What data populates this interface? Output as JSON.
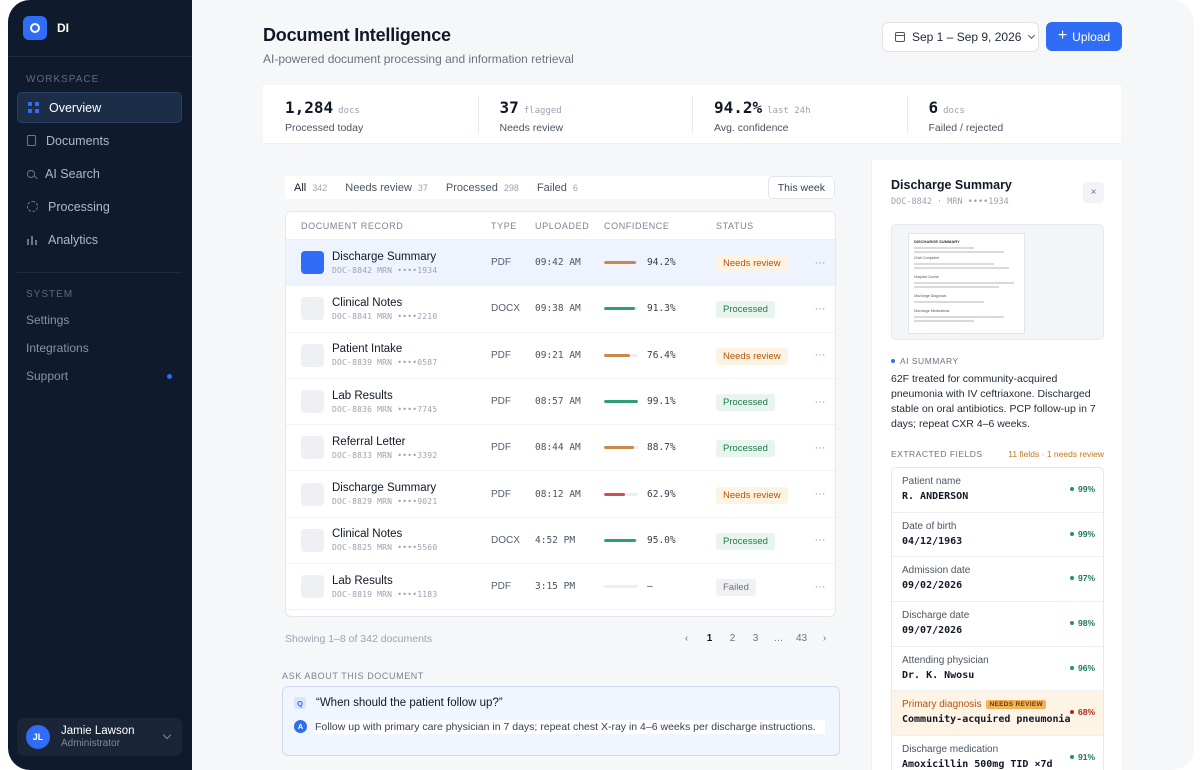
{
  "brand": {
    "name": "DI"
  },
  "sidebar": {
    "workspace_label": "WORKSPACE",
    "items": [
      {
        "label": "Overview",
        "icon": "grid-icon",
        "active": true
      },
      {
        "label": "Documents",
        "icon": "document-icon"
      },
      {
        "label": "AI Search",
        "icon": "search-icon"
      },
      {
        "label": "Processing",
        "icon": "gear-icon"
      },
      {
        "label": "Analytics",
        "icon": "bar-chart-icon"
      }
    ],
    "system_label": "SYSTEM",
    "system_items": [
      {
        "label": "Settings"
      },
      {
        "label": "Integrations"
      },
      {
        "label": "Support",
        "has_dot": true
      }
    ],
    "user": {
      "initials": "JL",
      "name": "Jamie Lawson",
      "role": "Administrator"
    }
  },
  "header": {
    "title": "Document Intelligence",
    "subtitle": "AI-powered document processing and information retrieval",
    "date_range": "Sep 1 – Sep 9, 2026",
    "upload_label": "Upload"
  },
  "stats": [
    {
      "value": "1,284",
      "unit": "docs",
      "label": "Processed today"
    },
    {
      "value": "37",
      "unit": "flagged",
      "label": "Needs review"
    },
    {
      "value": "94.2%",
      "unit": "last 24h",
      "label": "Avg. confidence"
    },
    {
      "value": "6",
      "unit": "docs",
      "label": "Failed / rejected"
    }
  ],
  "tabs": [
    {
      "label": "All",
      "count": "342",
      "active": true
    },
    {
      "label": "Needs review",
      "count": "37"
    },
    {
      "label": "Processed",
      "count": "298"
    },
    {
      "label": "Failed",
      "count": "6"
    }
  ],
  "week_label": "This week",
  "table": {
    "headers": [
      "DOCUMENT RECORD",
      "TYPE",
      "UPLOADED",
      "CONFIDENCE",
      "STATUS"
    ],
    "rows": [
      {
        "name": "Discharge Summary",
        "sub": "DOC-8842  MRN ••••1934",
        "type": "PDF",
        "uploaded": "09:42 AM",
        "confidence": "94.2%",
        "conf_value": 0.942,
        "bar_color": "#c8894a",
        "status": "Needs review",
        "status_kind": "review",
        "selected": true
      },
      {
        "name": "Clinical Notes",
        "sub": "DOC-8841  MRN ••••2210",
        "type": "DOCX",
        "uploaded": "09:38 AM",
        "confidence": "91.3%",
        "conf_value": 0.913,
        "bar_color": "#2e9e73",
        "status": "Processed",
        "status_kind": "processed"
      },
      {
        "name": "Patient Intake",
        "sub": "DOC-8839  MRN ••••0587",
        "type": "PDF",
        "uploaded": "09:21 AM",
        "confidence": "76.4%",
        "conf_value": 0.764,
        "bar_color": "#c8894a",
        "status": "Needs review",
        "status_kind": "review"
      },
      {
        "name": "Lab Results",
        "sub": "DOC-8836  MRN ••••7745",
        "type": "PDF",
        "uploaded": "08:57 AM",
        "confidence": "99.1%",
        "conf_value": 0.991,
        "bar_color": "#2e9e73",
        "status": "Processed",
        "status_kind": "processed"
      },
      {
        "name": "Referral Letter",
        "sub": "DOC-8833  MRN ••••3392",
        "type": "PDF",
        "uploaded": "08:44 AM",
        "confidence": "88.7%",
        "conf_value": 0.887,
        "bar_color": "#c8894a",
        "status": "Processed",
        "status_kind": "processed"
      },
      {
        "name": "Discharge Summary",
        "sub": "DOC-8829  MRN ••••9021",
        "type": "PDF",
        "uploaded": "08:12 AM",
        "confidence": "62.9%",
        "conf_value": 0.629,
        "bar_color": "#d05050",
        "status": "Needs review",
        "status_kind": "review"
      },
      {
        "name": "Clinical Notes",
        "sub": "DOC-8825  MRN ••••5560",
        "type": "DOCX",
        "uploaded": "4:52 PM",
        "confidence": "95.0%",
        "conf_value": 0.95,
        "bar_color": "#2e9e73",
        "status": "Processed",
        "status_kind": "processed"
      },
      {
        "name": "Lab Results",
        "sub": "DOC-8819  MRN ••••1183",
        "type": "PDF",
        "uploaded": "3:15 PM",
        "confidence": "—",
        "conf_value": 0,
        "bar_color": "#eceef2",
        "status": "Failed",
        "status_kind": "failed"
      }
    ],
    "more_label": "···"
  },
  "pager": {
    "summary": "Showing 1–8 of 342 documents",
    "prev": "‹",
    "pages": [
      "1",
      "2",
      "3",
      "…",
      "43"
    ],
    "next": "›"
  },
  "ask": {
    "label": "ASK ABOUT THIS DOCUMENT",
    "q_badge": "Q",
    "question": "“When should the patient follow up?”",
    "a_badge": "A",
    "answer": "Follow up with primary care physician in 7 days; repeat chest X-ray in 4–6 weeks per discharge instructions."
  },
  "panel": {
    "title": "Discharge Summary",
    "sub": "DOC-8842 · MRN ••••1934",
    "close": "×",
    "preview": {
      "heading": "DISCHARGE SUMMARY",
      "sections": [
        "Chief Complaint",
        "Hospital Course",
        "Discharge Diagnosis",
        "Discharge Medications"
      ]
    },
    "ai_label": "AI SUMMARY",
    "ai_text": "62F treated for community-acquired pneumonia with IV ceftriaxone. Discharged stable on oral antibiotics. PCP follow-up in 7 days; repeat CXR 4–6 weeks.",
    "fields_label": "EXTRACTED FIELDS",
    "fields_count": "11 fields · 1 needs review",
    "fields": [
      {
        "label": "Patient name",
        "value": "R. ANDERSON",
        "conf": "99%"
      },
      {
        "label": "Date of birth",
        "value": "04/12/1963",
        "conf": "99%"
      },
      {
        "label": "Admission date",
        "value": "09/02/2026",
        "conf": "97%"
      },
      {
        "label": "Discharge date",
        "value": "09/07/2026",
        "conf": "98%"
      },
      {
        "label": "Attending physician",
        "value": "Dr. K. Nwosu",
        "conf": "96%"
      },
      {
        "label": "Primary diagnosis",
        "value": "Community-acquired pneumonia",
        "conf": "68%",
        "warn": true,
        "badge": "NEEDS REVIEW"
      },
      {
        "label": "Discharge medication",
        "value": "Amoxicillin 500mg TID ×7d",
        "conf": "91%"
      }
    ]
  },
  "colors": {
    "accent": "#2f6df6",
    "sidebar": "#0f1b2d",
    "review": "#b45309",
    "processed": "#1b7a4a"
  }
}
